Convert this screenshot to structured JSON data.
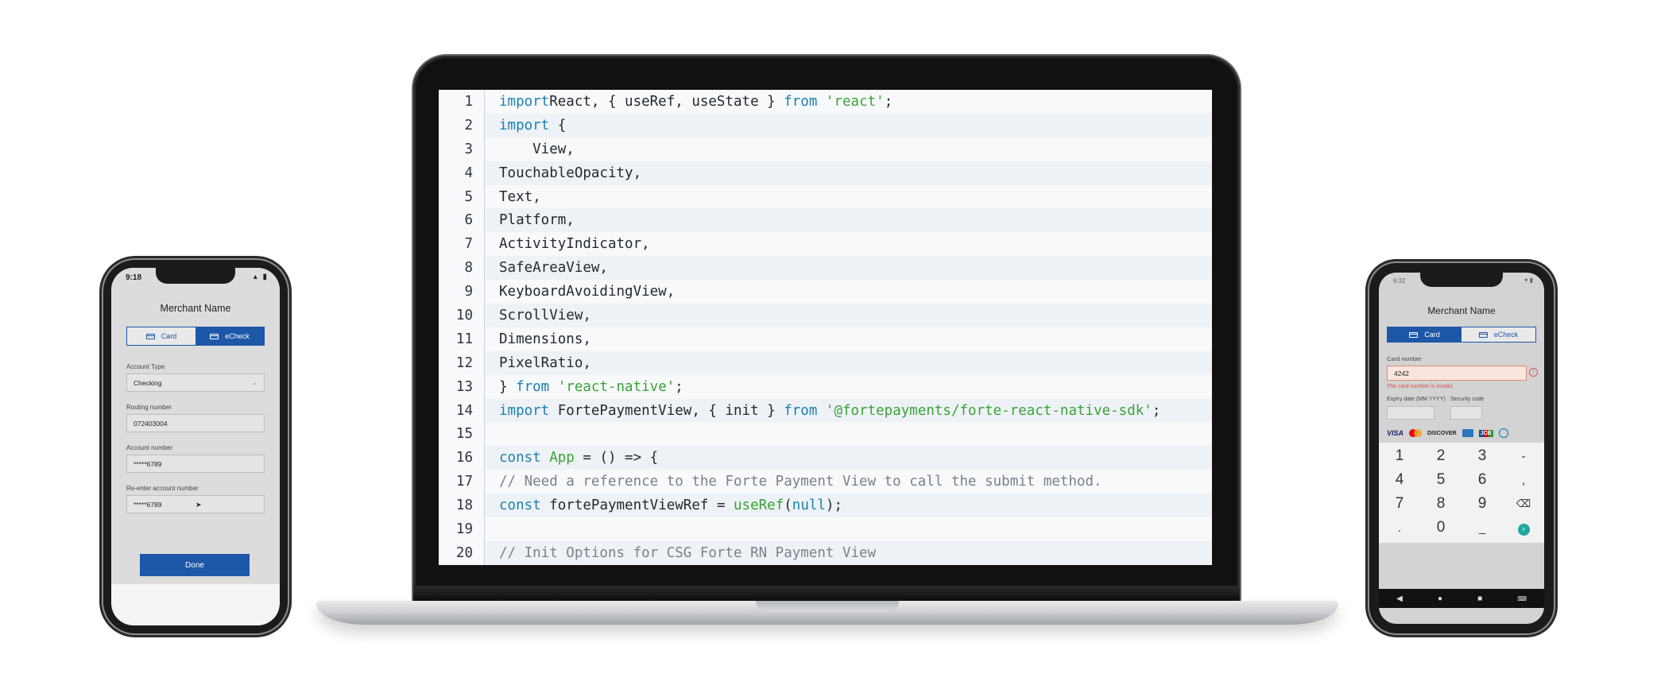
{
  "laptop": {
    "code_lines": [
      {
        "num": "1",
        "tokens": [
          [
            "kw",
            "import"
          ],
          [
            "",
            "React, { useRef, useState } "
          ],
          [
            "kw",
            "from"
          ],
          [
            "",
            ""
          ],
          [
            "str",
            " 'react'"
          ],
          [
            "",
            ";"
          ]
        ]
      },
      {
        "num": "2",
        "tokens": [
          [
            "kw",
            "import"
          ],
          [
            "",
            " {"
          ]
        ]
      },
      {
        "num": "3",
        "tokens": [
          [
            "",
            "    View,"
          ]
        ]
      },
      {
        "num": "4",
        "tokens": [
          [
            "",
            "TouchableOpacity,"
          ]
        ]
      },
      {
        "num": "5",
        "tokens": [
          [
            "",
            "Text,"
          ]
        ]
      },
      {
        "num": "6",
        "tokens": [
          [
            "",
            "Platform,"
          ]
        ]
      },
      {
        "num": "7",
        "tokens": [
          [
            "",
            "ActivityIndicator,"
          ]
        ]
      },
      {
        "num": "8",
        "tokens": [
          [
            "",
            "SafeAreaView,"
          ]
        ]
      },
      {
        "num": "9",
        "tokens": [
          [
            "",
            "KeyboardAvoidingView,"
          ]
        ]
      },
      {
        "num": "10",
        "tokens": [
          [
            "",
            "ScrollView,"
          ]
        ]
      },
      {
        "num": "11",
        "tokens": [
          [
            "",
            "Dimensions,"
          ]
        ]
      },
      {
        "num": "12",
        "tokens": [
          [
            "",
            "PixelRatio,"
          ]
        ]
      },
      {
        "num": "13",
        "tokens": [
          [
            "",
            "} "
          ],
          [
            "kw",
            "from"
          ],
          [
            "str",
            " 'react-native'"
          ],
          [
            "",
            ";"
          ]
        ]
      },
      {
        "num": "14",
        "tokens": [
          [
            "kw",
            "import"
          ],
          [
            "",
            " FortePaymentView, { init } "
          ],
          [
            "kw",
            "from"
          ],
          [
            "str",
            " '@fortepayments/forte-react-native-sdk'"
          ],
          [
            "",
            ";"
          ]
        ]
      },
      {
        "num": "15",
        "tokens": [
          [
            "",
            ""
          ]
        ]
      },
      {
        "num": "16",
        "tokens": [
          [
            "kw",
            "const"
          ],
          [
            "fn",
            " App"
          ],
          [
            "",
            " = () => {"
          ]
        ]
      },
      {
        "num": "17",
        "tokens": [
          [
            "cm",
            "// Need a reference to the Forte Payment View to call the submit method."
          ]
        ]
      },
      {
        "num": "18",
        "tokens": [
          [
            "kw",
            "const"
          ],
          [
            "",
            " fortePaymentViewRef = "
          ],
          [
            "fn",
            "useRef"
          ],
          [
            "",
            "("
          ],
          [
            "lit",
            "null"
          ],
          [
            "",
            ");"
          ]
        ]
      },
      {
        "num": "19",
        "tokens": [
          [
            "",
            ""
          ]
        ]
      },
      {
        "num": "20",
        "tokens": [
          [
            "cm",
            "// Init Options for CSG Forte RN Payment View"
          ]
        ]
      }
    ]
  },
  "ios_phone": {
    "time": "9:18",
    "merchant_name": "Merchant Name",
    "tabs": {
      "card_label": "Card",
      "echeck_label": "eCheck",
      "active": "eCheck"
    },
    "account_type_label": "Account Type",
    "account_type_value": "Checking",
    "routing_label": "Routing number",
    "routing_value": "072403004",
    "account_label": "Account number",
    "account_value": "*****6789",
    "reenter_label": "Re-enter account number",
    "reenter_value": "*****6789",
    "done_label": "Done"
  },
  "android_phone": {
    "time": "6:32",
    "merchant_name": "Merchant Name",
    "tabs": {
      "card_label": "Card",
      "echeck_label": "eCheck",
      "active": "Card"
    },
    "card_number_label": "Card number",
    "card_number_value": "4242",
    "card_error": "The card number is invalid.",
    "expiry_label": "Expiry date (MM YYYY)",
    "security_label": "Security code",
    "card_brands": [
      "VISA",
      "mastercard",
      "DISCOVER",
      "amex",
      "JCB",
      "diners"
    ],
    "keypad": [
      [
        "1",
        "2",
        "3",
        "-"
      ],
      [
        "4",
        "5",
        "6",
        ","
      ],
      [
        "7",
        "8",
        "9",
        "⌫"
      ],
      [
        ".",
        "0",
        "_",
        "›"
      ]
    ],
    "colors": {
      "accent": "#1d57a8",
      "error": "#d9534f",
      "next_key": "#1ea7a0"
    }
  }
}
